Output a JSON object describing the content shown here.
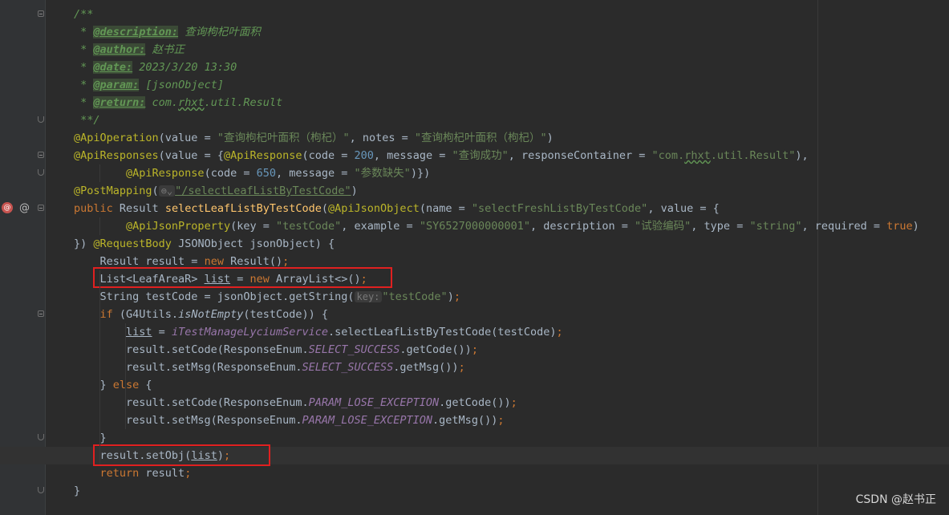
{
  "editor": {
    "lines": [
      {
        "fold": "open",
        "segs": [
          [
            "cm",
            "/**"
          ]
        ]
      },
      {
        "segs": [
          [
            "cm",
            " * "
          ],
          [
            "tag",
            "@description:"
          ],
          [
            "cm",
            " 查询枸杞叶面积"
          ]
        ]
      },
      {
        "segs": [
          [
            "cm",
            " * "
          ],
          [
            "tag",
            "@author:"
          ],
          [
            "cm",
            " 赵书正"
          ]
        ]
      },
      {
        "segs": [
          [
            "cm",
            " * "
          ],
          [
            "tag",
            "@date:"
          ],
          [
            "cm",
            " 2023/3/20 13:30"
          ]
        ]
      },
      {
        "segs": [
          [
            "cm",
            " * "
          ],
          [
            "tag",
            "@param:"
          ],
          [
            "cm",
            " [jsonObject]"
          ]
        ]
      },
      {
        "segs": [
          [
            "cm",
            " * "
          ],
          [
            "tag",
            "@return:"
          ],
          [
            "cm",
            " com."
          ],
          [
            "cm wavy",
            "rhxt"
          ],
          [
            "cm",
            ".util.Result"
          ]
        ]
      },
      {
        "fold": "end",
        "segs": [
          [
            "cm",
            " **/"
          ]
        ]
      },
      {
        "segs": [
          [
            "ann",
            "@ApiOperation"
          ],
          [
            "",
            "(value = "
          ],
          [
            "str",
            "\"查询枸杞叶面积（枸杞）\""
          ],
          [
            "",
            ", notes = "
          ],
          [
            "str",
            "\"查询枸杞叶面积（枸杞）\""
          ],
          [
            "",
            ")"
          ]
        ]
      },
      {
        "fold": "open",
        "segs": [
          [
            "ann",
            "@ApiResponses"
          ],
          [
            "",
            "(value = {"
          ],
          [
            "ann",
            "@ApiResponse"
          ],
          [
            "",
            "(code = "
          ],
          [
            "num",
            "200"
          ],
          [
            "",
            ", message = "
          ],
          [
            "str",
            "\"查询成功\""
          ],
          [
            "",
            ", responseContainer = "
          ],
          [
            "str",
            "\"com."
          ],
          [
            "str wavy",
            "rhxt"
          ],
          [
            "str",
            ".util.Result\""
          ],
          [
            "",
            "),"
          ]
        ]
      },
      {
        "fold": "end",
        "segs": [
          [
            "",
            "        "
          ],
          [
            "ann",
            "@ApiResponse"
          ],
          [
            "",
            "(code = "
          ],
          [
            "num",
            "650"
          ],
          [
            "",
            ", message = "
          ],
          [
            "str",
            "\"参数缺失\""
          ],
          [
            "",
            ")})"
          ]
        ]
      },
      {
        "segs": [
          [
            "ann",
            "@PostMapping"
          ],
          [
            "",
            "("
          ],
          [
            "hint",
            "⊜⌄"
          ],
          [
            "str ul",
            "\"/selectLeafListByTestCode\""
          ],
          [
            "",
            ")"
          ]
        ]
      },
      {
        "icons": true,
        "fold": "open",
        "segs": [
          [
            "kw",
            "public "
          ],
          [
            "",
            "Result "
          ],
          [
            "fn",
            "selectLeafListByTestCode"
          ],
          [
            "",
            "("
          ],
          [
            "ann",
            "@ApiJsonObject"
          ],
          [
            "",
            "(name = "
          ],
          [
            "str",
            "\"selectFreshListByTestCode\""
          ],
          [
            "",
            ", value = {"
          ]
        ]
      },
      {
        "segs": [
          [
            "",
            "        "
          ],
          [
            "ann",
            "@ApiJsonProperty"
          ],
          [
            "",
            "(key = "
          ],
          [
            "str",
            "\"testCode\""
          ],
          [
            "",
            ", example = "
          ],
          [
            "str",
            "\"SY6527000000001\""
          ],
          [
            "",
            ", description = "
          ],
          [
            "str",
            "\"试验编码\""
          ],
          [
            "",
            ", type = "
          ],
          [
            "str",
            "\"string\""
          ],
          [
            "",
            ", required = "
          ],
          [
            "kw",
            "true"
          ],
          [
            "",
            ")"
          ]
        ]
      },
      {
        "segs": [
          [
            "",
            "}) "
          ],
          [
            "ann",
            "@RequestBody"
          ],
          [
            "",
            " JSONObject jsonObject) {"
          ]
        ]
      },
      {
        "segs": [
          [
            "",
            "    Result result = "
          ],
          [
            "kw",
            "new "
          ],
          [
            "",
            "Result()"
          ],
          [
            "kw",
            ";"
          ]
        ]
      },
      {
        "segs": [
          [
            "",
            "    List<LeafAreaR> "
          ],
          [
            "ul",
            "list"
          ],
          [
            "",
            " = "
          ],
          [
            "kw",
            "new "
          ],
          [
            "",
            "ArrayList<>()"
          ],
          [
            "kw",
            ";"
          ]
        ]
      },
      {
        "segs": [
          [
            "",
            "    String testCode = jsonObject.getString("
          ],
          [
            "hint",
            "key:"
          ],
          [
            "str",
            "\"testCode\""
          ],
          [
            "",
            ")"
          ],
          [
            "kw",
            ";"
          ]
        ]
      },
      {
        "fold": "open",
        "segs": [
          [
            "",
            "    "
          ],
          [
            "kw",
            "if "
          ],
          [
            "",
            "(G4Utils."
          ],
          [
            "it",
            "isNotEmpty"
          ],
          [
            "",
            "(testCode)) {"
          ]
        ]
      },
      {
        "segs": [
          [
            "",
            "        "
          ],
          [
            "ul",
            "list"
          ],
          [
            "",
            " = "
          ],
          [
            "const",
            "iTestManageLyciumService"
          ],
          [
            "",
            ".selectLeafListByTestCode(testCode)"
          ],
          [
            "kw",
            ";"
          ]
        ]
      },
      {
        "segs": [
          [
            "",
            "        result.setCode(ResponseEnum."
          ],
          [
            "const",
            "SELECT_SUCCESS"
          ],
          [
            "",
            ".getCode())"
          ],
          [
            "kw",
            ";"
          ]
        ]
      },
      {
        "segs": [
          [
            "",
            "        result.setMsg(ResponseEnum."
          ],
          [
            "const",
            "SELECT_SUCCESS"
          ],
          [
            "",
            ".getMsg())"
          ],
          [
            "kw",
            ";"
          ]
        ]
      },
      {
        "segs": [
          [
            "",
            "    } "
          ],
          [
            "kw",
            "else "
          ],
          [
            "",
            "{"
          ]
        ]
      },
      {
        "segs": [
          [
            "",
            "        result.setCode(ResponseEnum."
          ],
          [
            "const",
            "PARAM_LOSE_EXCEPTION"
          ],
          [
            "",
            ".getCode())"
          ],
          [
            "kw",
            ";"
          ]
        ]
      },
      {
        "segs": [
          [
            "",
            "        result.setMsg(ResponseEnum."
          ],
          [
            "const",
            "PARAM_LOSE_EXCEPTION"
          ],
          [
            "",
            ".getMsg())"
          ],
          [
            "kw",
            ";"
          ]
        ]
      },
      {
        "fold": "end",
        "segs": [
          [
            "",
            "    }"
          ]
        ]
      },
      {
        "current": true,
        "segs": [
          [
            "",
            "    result.setObj("
          ],
          [
            "ul",
            "list"
          ],
          [
            "",
            ")"
          ],
          [
            "kw",
            ";"
          ]
        ]
      },
      {
        "segs": [
          [
            "",
            "    "
          ],
          [
            "kw",
            "return "
          ],
          [
            "",
            "result"
          ],
          [
            "kw",
            ";"
          ]
        ]
      },
      {
        "fold": "end",
        "segs": [
          [
            "",
            "}"
          ]
        ]
      }
    ]
  },
  "gutter_icons": {
    "override": "@",
    "annotation": "@"
  },
  "watermark": "CSDN @赵书正"
}
